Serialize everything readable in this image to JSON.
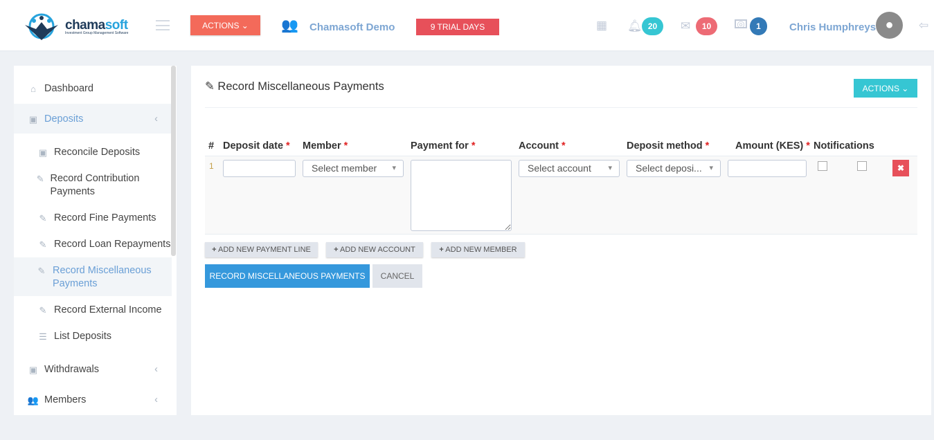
{
  "header": {
    "logo_name_a": "chama",
    "logo_name_b": "soft",
    "logo_tagline": "Investment Group Management Software",
    "actions_label": "ACTIONS",
    "group_name": "Chamasoft Demo",
    "trial_label": "9 TRIAL DAYS",
    "notifications_count": "20",
    "messages_count": "10",
    "payments_count": "1",
    "user_name": "Chris Humphreys",
    "colors": {
      "actions": "#f36a5a",
      "trial": "#e7505a",
      "notif": "#36c6d3",
      "msg": "#ed6b75",
      "pay": "#337ab7"
    }
  },
  "sidebar": {
    "items": [
      {
        "label": "Dashboard",
        "icon": "home-icon"
      },
      {
        "label": "Deposits",
        "icon": "money-icon",
        "active": true
      },
      {
        "label": "Reconcile Deposits",
        "icon": "money-icon"
      },
      {
        "label": "Record Contribution Payments",
        "icon": "pencil-icon"
      },
      {
        "label": "Record Fine Payments",
        "icon": "pencil-icon"
      },
      {
        "label": "Record Loan Repayments",
        "icon": "pencil-icon"
      },
      {
        "label": "Record Miscellaneous Payments",
        "icon": "pencil-icon",
        "active": true
      },
      {
        "label": "Record External Income",
        "icon": "pencil-icon"
      },
      {
        "label": "List Deposits",
        "icon": "list-icon"
      },
      {
        "label": "Withdrawals",
        "icon": "money-icon"
      },
      {
        "label": "Members",
        "icon": "users-icon"
      }
    ]
  },
  "main": {
    "title": "Record Miscellaneous Payments",
    "actions_label": "ACTIONS",
    "columns": [
      "#",
      "Deposit date",
      "Member",
      "Payment for",
      "Account",
      "Deposit method",
      "Amount (KES)",
      "Notifications"
    ],
    "required_mark": "*",
    "row": {
      "index": "1",
      "deposit_date": "",
      "member_placeholder": "Select member",
      "payment_for": "",
      "account_placeholder": "Select account",
      "method_placeholder": "Select deposi...",
      "amount": ""
    },
    "add_line": "ADD NEW PAYMENT LINE",
    "add_account": "ADD NEW ACCOUNT",
    "add_member": "ADD NEW MEMBER",
    "submit": "RECORD MISCELLANEOUS PAYMENTS",
    "cancel": "CANCEL"
  }
}
